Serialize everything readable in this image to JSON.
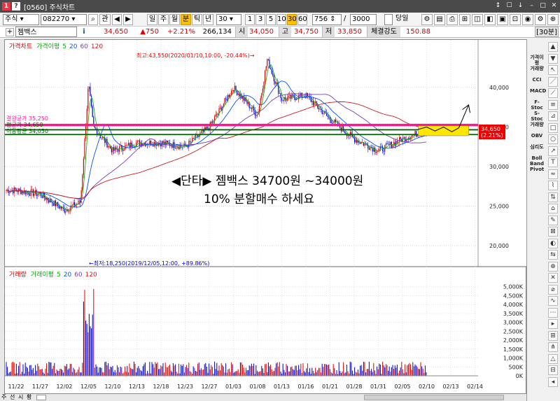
{
  "window": {
    "code": "[0560]",
    "title": "주식차트",
    "controls": [
      "↕",
      "☐",
      "↓",
      "–",
      "□",
      "✕"
    ]
  },
  "toolbar": {
    "market": "주식",
    "code": "082270",
    "search": "⌕",
    "chart_btn": "관",
    "periods": [
      "일",
      "주",
      "월",
      "분",
      "틱",
      "년"
    ],
    "selected_period": "분",
    "interval": "30",
    "quick": [
      "1",
      "3",
      "5",
      "10",
      "30",
      "60"
    ],
    "selected_quick": "30",
    "count": "756",
    "count_sep": "/",
    "count_total": "3000",
    "daily_label": "당일"
  },
  "quote": {
    "name": "젬백스",
    "info": "i",
    "price": "34,650",
    "change": "▲750",
    "change_pct": "+2.21%",
    "volume": "266,134",
    "open_label": "시",
    "open": "34,050",
    "high_label": "고",
    "high": "34,750",
    "low_label": "저",
    "low": "33,850",
    "strength_label": "체결강도",
    "strength": "150.88",
    "timeframe": "[30분]"
  },
  "price_panel": {
    "legend": {
      "title": "가격차트",
      "ma_label": "가격이평",
      "ma": [
        "5",
        "20",
        "60",
        "120"
      ]
    },
    "y_ticks": [
      "40,000",
      "35,000",
      "30,000",
      "25,000",
      "20,000"
    ],
    "high_note": "최고:43,550(2020/01/10,10:00, -20.44%)→",
    "low_note": "←최저:18,250(2019/12/05,12:00, +89.86%)",
    "current_price": "34,650",
    "current_pct": "(2.21%)",
    "line_labels": [
      "결원균가 35,250",
      "평균가 34,650",
      "이동평균 34,050"
    ],
    "annotation_line1": "◀단타▶ 젬백스 34700원 ~34000원",
    "annotation_line2": "10% 분할매수 하세요"
  },
  "volume_panel": {
    "legend": {
      "title": "거래량",
      "ma_label": "거래이평",
      "ma": [
        "5",
        "20",
        "60",
        "120"
      ]
    },
    "y_ticks": [
      "5,000K",
      "4,500K",
      "4,000K",
      "3,500K",
      "3,000K",
      "2,500K",
      "2,000K",
      "1,500K",
      "1,000K",
      "500K",
      "0K"
    ]
  },
  "x_ticks": [
    "11/22",
    "11/27",
    "12/02",
    "12/05",
    "12/10",
    "12/13",
    "12/18",
    "12/23",
    "12/27",
    "01/03",
    "01/08",
    "01/13",
    "01/16",
    "01/21",
    "01/28",
    "01/31",
    "02/05",
    "02/10",
    "02/13",
    "02/14"
  ],
  "sidebar": {
    "indicators": [
      "가격이평",
      "거래량",
      "CCI",
      "MACD",
      "F-Stoc",
      "S-Stoc",
      "거래량",
      "OBV",
      "심리도",
      "Boll Band",
      "Pivot"
    ]
  },
  "bottom_tabs": [
    "주",
    "선",
    "시",
    "황"
  ],
  "colors": {
    "up": "#e00000",
    "down": "#0000d0",
    "ma5": "#14b414",
    "ma20": "#0050ff",
    "ma60": "#7a3cb4",
    "ma120": "#c81e1e",
    "resistance": "#ff1493",
    "zone": "#ffe600",
    "support": "#006400"
  },
  "chart_data": {
    "type": "line",
    "title": "",
    "ylabel": "",
    "ylim": [
      17500,
      45000
    ],
    "x_range": [
      "11/22",
      "02/14"
    ],
    "series": [
      {
        "name": "가격차트",
        "x": [
          "11/22",
          "11/27",
          "12/02",
          "12/04",
          "12/05",
          "12/06",
          "12/10",
          "12/13",
          "12/18",
          "12/23",
          "12/27",
          "01/03",
          "01/08",
          "01/10",
          "01/13",
          "01/16",
          "01/21",
          "01/28",
          "01/31",
          "02/05",
          "02/10"
        ],
        "values": [
          27000,
          26500,
          24500,
          25500,
          40500,
          35000,
          32000,
          33000,
          33000,
          32500,
          35000,
          40000,
          36500,
          43550,
          38500,
          39000,
          36000,
          33500,
          32000,
          33500,
          34650
        ]
      }
    ],
    "horizontal_lines": [
      35250,
      34650,
      34050
    ],
    "annotation": "◀단타▶ 젬백스 34700원 ~34000원 10% 분할매수 하세요"
  }
}
